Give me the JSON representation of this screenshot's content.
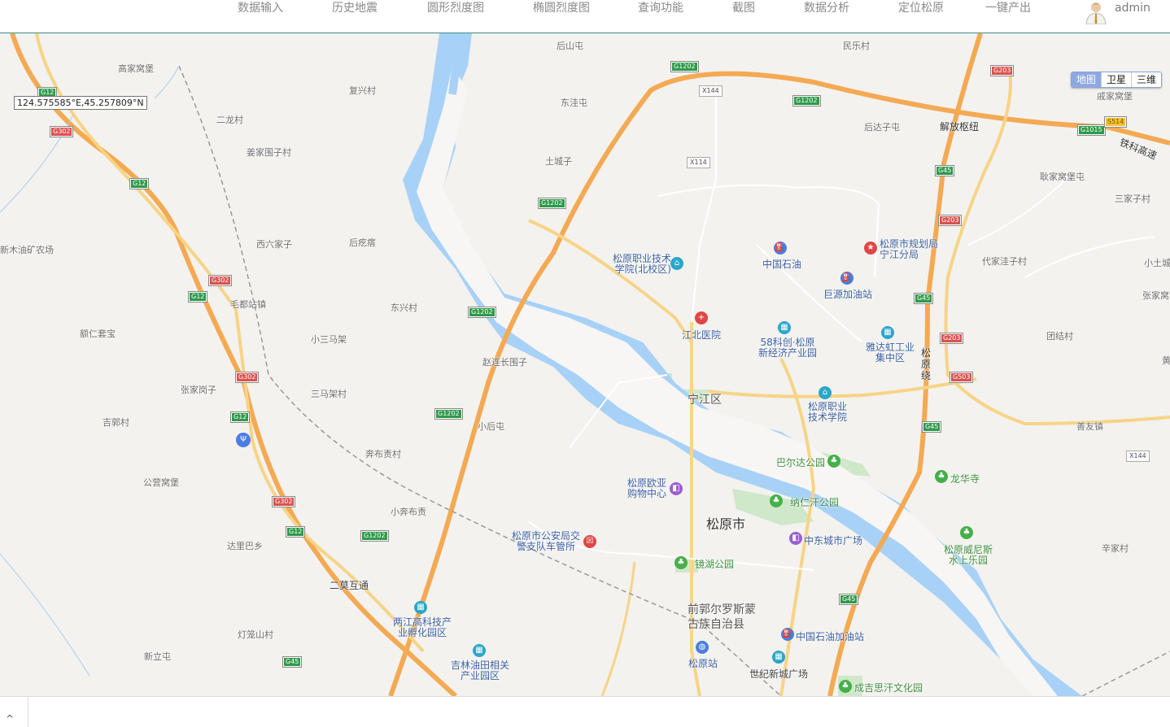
{
  "nav": {
    "items": [
      "数据输入",
      "历史地震",
      "圆形烈度图",
      "椭圆烈度图",
      "查询功能",
      "截图",
      "数据分析",
      "定位松原",
      "一键产出"
    ],
    "user": "admin"
  },
  "map": {
    "coordinate": "124.575585°E,45.257809°N",
    "maptype": [
      "地图",
      "卫星",
      "三维"
    ],
    "active_maptype": "地图",
    "labels": {
      "city": "松原市",
      "district": "宁江区",
      "county": "前郭尔罗斯蒙古族自治县",
      "towns": [
        "高家窝堡",
        "复兴村",
        "二龙村",
        "姜家围子村",
        "新木油矿农场",
        "西六家子",
        "后疙瘩",
        "毛都站镇",
        "东兴村",
        "额仁套宝",
        "小三马架",
        "赵连长围子",
        "三马架村",
        "张家岗子",
        "吉郭村",
        "小后屯",
        "奔布责村",
        "公营窝堡",
        "小奔布责",
        "达里巴乡",
        "二莫互通",
        "灯笼山村",
        "新立屯",
        "后山屯",
        "东洼屯",
        "土城子",
        "民乐村",
        "戚家窝堡",
        "后达子屯",
        "耿家窝堡屯",
        "三家子村",
        "代家洼子村",
        "小土城",
        "张家窝",
        "团结村",
        "善友镇",
        "辛家村",
        "解放枢纽",
        "铁科高速",
        "松原绕",
        "黄家村"
      ],
      "pois": [
        "松原职业技术学院(北校区)",
        "中国石油",
        "松原市规划局宁江分局",
        "巨源加油站",
        "江北医院",
        "58科创·松原新经济产业园",
        "雅达虹工业集中区",
        "松原职业技术学院",
        "松原欧亚购物中心",
        "松原市公安局交警支队车管所",
        "中东城市广场",
        "两江高科技产业孵化园区",
        "吉林油田相关产业园区",
        "松原站",
        "中国石油加油站",
        "世纪新城广场"
      ],
      "parks": [
        "巴尔达公园",
        "纳仁汗公园",
        "龙华寺",
        "松原威尼斯水上乐园",
        "镜湖公园",
        "成吉思汗文化园"
      ]
    },
    "shields": [
      "G12",
      "G302",
      "G1202",
      "G45",
      "G203",
      "G1015",
      "S514",
      "G503",
      "X144",
      "X114"
    ]
  },
  "bottom": {
    "toggle": "^"
  }
}
